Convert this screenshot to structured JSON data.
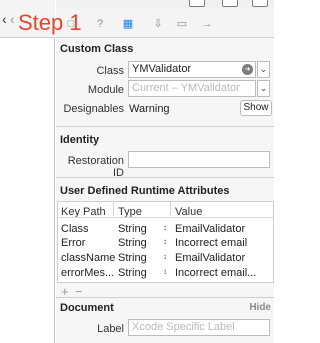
{
  "annotation": {
    "step": "Step 1"
  },
  "left_pane": {
    "back_glyph": "‹",
    "nav_glyph": "‹"
  },
  "inspector_tabs": [
    {
      "name": "file-icon",
      "glyph": "□"
    },
    {
      "name": "quick-help-icon",
      "glyph": "?"
    },
    {
      "name": "identity-icon",
      "glyph": "▦",
      "selected": true
    },
    {
      "name": "attributes-icon",
      "glyph": "⇩"
    },
    {
      "name": "size-icon",
      "glyph": "▭"
    },
    {
      "name": "connections-icon",
      "glyph": "→"
    }
  ],
  "custom_class": {
    "title": "Custom Class",
    "class_label": "Class",
    "class_value": "YMValidator",
    "module_label": "Module",
    "module_placeholder": "Current – YMValidator",
    "designables_label": "Designables",
    "designables_value": "Warning",
    "show_button": "Show"
  },
  "identity": {
    "title": "Identity",
    "restoration_id_label": "Restoration ID",
    "restoration_id_value": ""
  },
  "runtime_attributes": {
    "title": "User Defined Runtime Attributes",
    "columns": [
      "Key Path",
      "Type",
      "Value"
    ],
    "rows": [
      {
        "key_path": "Class",
        "type": "String",
        "value": "EmailValidator"
      },
      {
        "key_path": "Error",
        "type": "String",
        "value": "Incorrect email"
      },
      {
        "key_path": "className",
        "type": "String",
        "value": "EmailValidator"
      },
      {
        "key_path": "errorMes...",
        "type": "String",
        "value": "Incorrect email..."
      }
    ],
    "add_glyph": "+",
    "remove_glyph": "−"
  },
  "document": {
    "title": "Document",
    "hide_label": "Hide",
    "label_label": "Label",
    "label_placeholder": "Xcode Specific Label"
  }
}
